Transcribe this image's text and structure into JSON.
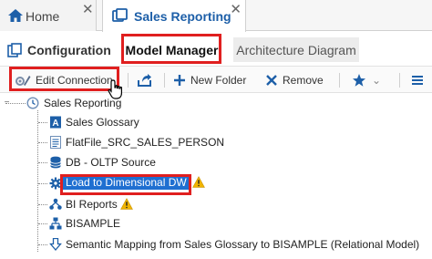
{
  "doc_tabs": [
    {
      "label": "Home",
      "icon": "home-icon",
      "close": "✕"
    },
    {
      "label": "Sales Reporting",
      "icon": "project-icon",
      "close": "✕"
    }
  ],
  "view_tabs": [
    {
      "label": "Configuration",
      "icon": "configuration-icon"
    },
    {
      "label": "Model Manager"
    },
    {
      "label": "Architecture Diagram"
    }
  ],
  "toolbar": {
    "edit_connection": "Edit Connection",
    "new_folder": "New Folder",
    "remove": "Remove",
    "dropdown": "⌄"
  },
  "tree": {
    "root": "Sales Reporting",
    "children": [
      {
        "label": "Sales Glossary",
        "icon": "glossary-icon"
      },
      {
        "label": "FlatFile_SRC_SALES_PERSON",
        "icon": "flat-file-icon"
      },
      {
        "label": "DB - OLTP Source",
        "icon": "database-icon"
      },
      {
        "label": "Load to Dimensional DW",
        "icon": "mapping-gear-icon",
        "warning": true,
        "selected": true
      },
      {
        "label": "BI Reports",
        "icon": "bi-report-icon",
        "warning": true
      },
      {
        "label": "BISAMPLE",
        "icon": "model-icon"
      },
      {
        "label": "Semantic Mapping from Sales Glossary to BISAMPLE (Relational Model)",
        "icon": "semantic-mapping-icon"
      }
    ]
  },
  "colors": {
    "accent": "#1d5fa8",
    "highlight_box": "#e01f1f",
    "selection": "#1f6fd1",
    "warning": "#f0b400"
  }
}
